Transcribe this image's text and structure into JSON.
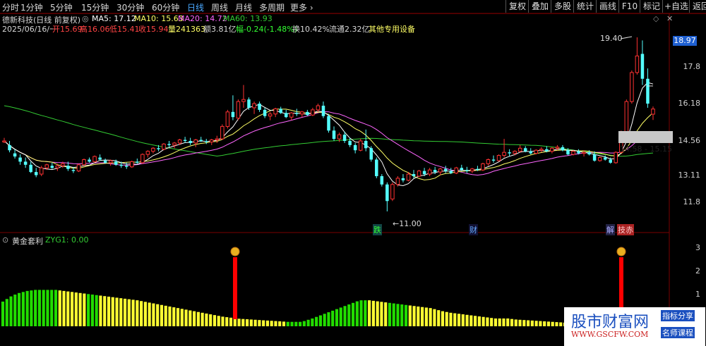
{
  "toolbar": {
    "periods": [
      "分时",
      "1分钟",
      "5分钟",
      "15分钟",
      "30分钟",
      "60分钟",
      "日线",
      "周线",
      "月线",
      "多周期",
      "更多"
    ],
    "active_period": "日线",
    "right_buttons": [
      "复权",
      "叠加",
      "多股",
      "统计",
      "画线",
      "F10",
      "标记",
      "+自选",
      "返回"
    ]
  },
  "header": {
    "title": "德新科技(日线 前复权)",
    "ma5": "MA5: 17.12",
    "ma10": "MA10: 15.63",
    "ma20": "MA20: 14.72",
    "ma60": "MA60: 13.93",
    "date": "2025/06/16/一",
    "open": "开15.69",
    "high": "高16.06",
    "low": "低15.41",
    "close": "收15.94",
    "volume": "量241363",
    "amount": "额3.81亿",
    "change": "幅-0.24(-1.48%)",
    "turnover": "换10.42%",
    "float": "流通2.32亿",
    "industry": "其他专用设备"
  },
  "colors": {
    "up": "#ff3232",
    "down": "#54ffff",
    "ma5": "#ffffff",
    "ma10": "#ffff66",
    "ma20": "#ff66ff",
    "ma60": "#33cc33",
    "bar_green": "#22dd00",
    "bar_yellow": "#ffff33",
    "signal": "#ff0000",
    "price_box": "#1e5fd0"
  },
  "annotations": {
    "high_label": "19.40",
    "low_label": "←11.00",
    "range_label": "14.58 - 15.15",
    "event_fall": "跌",
    "event_finance": "财",
    "event_unlock": "解",
    "event_special": "技赤",
    "current_price": "18.97"
  },
  "indicator": {
    "name": "黄金套利",
    "value": "ZYG1: 0.00"
  },
  "watermark": {
    "site_cn": "股市财富网",
    "url": "WWW.GSCFW.COM",
    "tag1": "指标分享",
    "tag2": "名师课程"
  },
  "chart_data": [
    {
      "type": "candlestick",
      "y_ticks": [
        11.8,
        13.11,
        14.56,
        16.18,
        17.8,
        18.97
      ],
      "ylim": [
        11.0,
        19.5
      ],
      "candles": [
        {
          "o": 14.35,
          "h": 14.55,
          "l": 14.3,
          "c": 14.4
        },
        {
          "o": 14.2,
          "h": 14.4,
          "l": 13.85,
          "c": 13.95
        },
        {
          "o": 13.8,
          "h": 14.0,
          "l": 13.55,
          "c": 13.65
        },
        {
          "o": 13.6,
          "h": 13.75,
          "l": 13.25,
          "c": 13.4
        },
        {
          "o": 13.4,
          "h": 13.6,
          "l": 13.1,
          "c": 13.25
        },
        {
          "o": 13.25,
          "h": 13.4,
          "l": 12.85,
          "c": 12.9
        },
        {
          "o": 12.9,
          "h": 13.1,
          "l": 12.65,
          "c": 12.75
        },
        {
          "o": 12.8,
          "h": 13.2,
          "l": 12.7,
          "c": 13.1
        },
        {
          "o": 13.1,
          "h": 13.3,
          "l": 13.0,
          "c": 13.25
        },
        {
          "o": 13.2,
          "h": 13.35,
          "l": 13.05,
          "c": 13.1
        },
        {
          "o": 13.1,
          "h": 13.3,
          "l": 12.95,
          "c": 13.2
        },
        {
          "o": 13.2,
          "h": 13.4,
          "l": 13.1,
          "c": 13.3
        },
        {
          "o": 13.2,
          "h": 13.4,
          "l": 12.95,
          "c": 13.05
        },
        {
          "o": 13.0,
          "h": 13.15,
          "l": 12.85,
          "c": 12.95
        },
        {
          "o": 12.95,
          "h": 13.3,
          "l": 12.9,
          "c": 13.25
        },
        {
          "o": 13.25,
          "h": 13.55,
          "l": 13.2,
          "c": 13.5
        },
        {
          "o": 13.5,
          "h": 13.6,
          "l": 13.35,
          "c": 13.4
        },
        {
          "o": 13.4,
          "h": 13.7,
          "l": 13.35,
          "c": 13.65
        },
        {
          "o": 13.6,
          "h": 13.75,
          "l": 13.45,
          "c": 13.5
        },
        {
          "o": 13.45,
          "h": 13.55,
          "l": 13.3,
          "c": 13.35
        },
        {
          "o": 13.35,
          "h": 13.5,
          "l": 13.2,
          "c": 13.45
        },
        {
          "o": 13.4,
          "h": 13.5,
          "l": 13.2,
          "c": 13.25
        },
        {
          "o": 13.25,
          "h": 13.4,
          "l": 13.1,
          "c": 13.2
        },
        {
          "o": 13.2,
          "h": 13.35,
          "l": 13.05,
          "c": 13.15
        },
        {
          "o": 13.15,
          "h": 13.45,
          "l": 13.1,
          "c": 13.4
        },
        {
          "o": 13.4,
          "h": 13.55,
          "l": 13.3,
          "c": 13.35
        },
        {
          "o": 13.35,
          "h": 13.8,
          "l": 13.3,
          "c": 13.75
        },
        {
          "o": 13.75,
          "h": 13.95,
          "l": 13.6,
          "c": 13.9
        },
        {
          "o": 13.9,
          "h": 14.1,
          "l": 13.8,
          "c": 14.05
        },
        {
          "o": 14.05,
          "h": 14.2,
          "l": 13.9,
          "c": 14.0
        },
        {
          "o": 14.0,
          "h": 14.3,
          "l": 13.95,
          "c": 14.25
        },
        {
          "o": 14.25,
          "h": 14.4,
          "l": 14.1,
          "c": 14.2
        },
        {
          "o": 14.2,
          "h": 14.35,
          "l": 14.05,
          "c": 14.3
        },
        {
          "o": 14.3,
          "h": 14.5,
          "l": 14.2,
          "c": 14.45
        },
        {
          "o": 14.45,
          "h": 14.6,
          "l": 14.3,
          "c": 14.4
        },
        {
          "o": 14.4,
          "h": 14.55,
          "l": 14.2,
          "c": 14.3
        },
        {
          "o": 14.3,
          "h": 14.5,
          "l": 14.1,
          "c": 14.45
        },
        {
          "o": 14.45,
          "h": 14.6,
          "l": 14.35,
          "c": 14.4
        },
        {
          "o": 14.4,
          "h": 14.5,
          "l": 14.25,
          "c": 14.35
        },
        {
          "o": 14.35,
          "h": 14.5,
          "l": 14.2,
          "c": 14.45
        },
        {
          "o": 14.45,
          "h": 14.65,
          "l": 14.3,
          "c": 14.5
        },
        {
          "o": 14.5,
          "h": 15.2,
          "l": 14.45,
          "c": 15.1
        },
        {
          "o": 15.1,
          "h": 15.9,
          "l": 15.0,
          "c": 15.8
        },
        {
          "o": 15.8,
          "h": 16.6,
          "l": 15.4,
          "c": 15.55
        },
        {
          "o": 15.5,
          "h": 16.4,
          "l": 15.4,
          "c": 16.3
        },
        {
          "o": 16.3,
          "h": 17.1,
          "l": 16.0,
          "c": 16.4
        },
        {
          "o": 16.4,
          "h": 16.5,
          "l": 15.9,
          "c": 16.0
        },
        {
          "o": 16.0,
          "h": 16.3,
          "l": 15.7,
          "c": 16.2
        },
        {
          "o": 16.2,
          "h": 16.3,
          "l": 15.8,
          "c": 15.9
        },
        {
          "o": 15.9,
          "h": 16.0,
          "l": 15.5,
          "c": 15.6
        },
        {
          "o": 15.6,
          "h": 15.8,
          "l": 15.4,
          "c": 15.7
        },
        {
          "o": 15.7,
          "h": 16.0,
          "l": 15.55,
          "c": 15.95
        },
        {
          "o": 15.95,
          "h": 16.05,
          "l": 15.7,
          "c": 15.75
        },
        {
          "o": 15.75,
          "h": 15.9,
          "l": 15.5,
          "c": 15.55
        },
        {
          "o": 15.55,
          "h": 15.8,
          "l": 15.4,
          "c": 15.75
        },
        {
          "o": 15.75,
          "h": 15.95,
          "l": 15.6,
          "c": 15.7
        },
        {
          "o": 15.7,
          "h": 15.85,
          "l": 15.55,
          "c": 15.8
        },
        {
          "o": 15.8,
          "h": 15.9,
          "l": 15.6,
          "c": 15.65
        },
        {
          "o": 15.65,
          "h": 16.0,
          "l": 15.6,
          "c": 15.9
        },
        {
          "o": 15.9,
          "h": 16.2,
          "l": 15.8,
          "c": 16.1
        },
        {
          "o": 16.1,
          "h": 16.3,
          "l": 15.5,
          "c": 15.6
        },
        {
          "o": 15.6,
          "h": 15.7,
          "l": 14.8,
          "c": 14.9
        },
        {
          "o": 14.9,
          "h": 15.1,
          "l": 14.4,
          "c": 14.5
        },
        {
          "o": 14.5,
          "h": 14.8,
          "l": 14.35,
          "c": 14.7
        },
        {
          "o": 14.7,
          "h": 14.85,
          "l": 14.3,
          "c": 14.4
        },
        {
          "o": 14.4,
          "h": 14.55,
          "l": 14.1,
          "c": 14.2
        },
        {
          "o": 14.2,
          "h": 14.3,
          "l": 13.8,
          "c": 13.95
        },
        {
          "o": 13.95,
          "h": 14.5,
          "l": 13.9,
          "c": 14.4
        },
        {
          "o": 14.4,
          "h": 14.95,
          "l": 13.9,
          "c": 14.05
        },
        {
          "o": 14.05,
          "h": 14.15,
          "l": 13.4,
          "c": 13.5
        },
        {
          "o": 13.5,
          "h": 13.6,
          "l": 12.6,
          "c": 12.7
        },
        {
          "o": 12.7,
          "h": 12.8,
          "l": 12.2,
          "c": 12.3
        },
        {
          "o": 12.3,
          "h": 12.4,
          "l": 11.0,
          "c": 11.5
        },
        {
          "o": 11.6,
          "h": 12.4,
          "l": 11.5,
          "c": 12.3
        },
        {
          "o": 12.3,
          "h": 12.7,
          "l": 12.2,
          "c": 12.6
        },
        {
          "o": 12.6,
          "h": 12.8,
          "l": 12.4,
          "c": 12.5
        },
        {
          "o": 12.5,
          "h": 12.9,
          "l": 12.45,
          "c": 12.8
        },
        {
          "o": 12.8,
          "h": 13.0,
          "l": 12.6,
          "c": 12.7
        },
        {
          "o": 12.7,
          "h": 13.0,
          "l": 12.65,
          "c": 12.95
        },
        {
          "o": 12.95,
          "h": 13.1,
          "l": 12.7,
          "c": 12.8
        },
        {
          "o": 12.8,
          "h": 13.1,
          "l": 12.7,
          "c": 13.0
        },
        {
          "o": 13.0,
          "h": 13.15,
          "l": 12.8,
          "c": 12.9
        },
        {
          "o": 12.9,
          "h": 13.1,
          "l": 12.75,
          "c": 13.05
        },
        {
          "o": 13.05,
          "h": 13.2,
          "l": 12.85,
          "c": 12.95
        },
        {
          "o": 12.95,
          "h": 13.1,
          "l": 12.8,
          "c": 12.85
        },
        {
          "o": 12.85,
          "h": 13.15,
          "l": 12.8,
          "c": 13.1
        },
        {
          "o": 13.1,
          "h": 13.25,
          "l": 12.95,
          "c": 13.0
        },
        {
          "o": 13.0,
          "h": 13.15,
          "l": 12.85,
          "c": 12.95
        },
        {
          "o": 12.95,
          "h": 13.1,
          "l": 12.85,
          "c": 13.05
        },
        {
          "o": 13.05,
          "h": 13.2,
          "l": 12.95,
          "c": 13.0
        },
        {
          "o": 13.0,
          "h": 13.35,
          "l": 12.95,
          "c": 13.3
        },
        {
          "o": 13.3,
          "h": 13.55,
          "l": 13.2,
          "c": 13.5
        },
        {
          "o": 13.5,
          "h": 13.7,
          "l": 13.35,
          "c": 13.45
        },
        {
          "o": 13.45,
          "h": 13.75,
          "l": 13.4,
          "c": 13.7
        },
        {
          "o": 13.7,
          "h": 14.5,
          "l": 13.6,
          "c": 13.85
        },
        {
          "o": 13.85,
          "h": 14.0,
          "l": 13.65,
          "c": 13.8
        },
        {
          "o": 13.8,
          "h": 13.95,
          "l": 13.7,
          "c": 13.9
        },
        {
          "o": 13.9,
          "h": 14.2,
          "l": 13.85,
          "c": 14.05
        },
        {
          "o": 14.05,
          "h": 14.15,
          "l": 13.85,
          "c": 13.9
        },
        {
          "o": 13.9,
          "h": 14.05,
          "l": 13.75,
          "c": 13.8
        },
        {
          "o": 13.8,
          "h": 14.0,
          "l": 13.75,
          "c": 13.95
        },
        {
          "o": 13.95,
          "h": 14.1,
          "l": 13.85,
          "c": 14.0
        },
        {
          "o": 14.0,
          "h": 14.15,
          "l": 13.85,
          "c": 13.9
        },
        {
          "o": 13.9,
          "h": 14.1,
          "l": 13.8,
          "c": 14.05
        },
        {
          "o": 14.05,
          "h": 14.2,
          "l": 13.95,
          "c": 14.1
        },
        {
          "o": 14.1,
          "h": 14.2,
          "l": 13.9,
          "c": 13.95
        },
        {
          "o": 13.95,
          "h": 14.05,
          "l": 13.7,
          "c": 13.75
        },
        {
          "o": 13.75,
          "h": 13.95,
          "l": 13.7,
          "c": 13.9
        },
        {
          "o": 13.9,
          "h": 14.0,
          "l": 13.75,
          "c": 13.8
        },
        {
          "o": 13.8,
          "h": 13.95,
          "l": 13.65,
          "c": 13.85
        },
        {
          "o": 13.85,
          "h": 13.95,
          "l": 13.7,
          "c": 13.75
        },
        {
          "o": 13.75,
          "h": 13.9,
          "l": 13.4,
          "c": 13.45
        },
        {
          "o": 13.45,
          "h": 13.65,
          "l": 13.4,
          "c": 13.6
        },
        {
          "o": 13.6,
          "h": 13.7,
          "l": 13.45,
          "c": 13.5
        },
        {
          "o": 13.5,
          "h": 13.6,
          "l": 13.3,
          "c": 13.35
        },
        {
          "o": 13.35,
          "h": 13.9,
          "l": 13.3,
          "c": 13.85
        },
        {
          "o": 13.85,
          "h": 14.9,
          "l": 13.8,
          "c": 14.85
        },
        {
          "o": 14.85,
          "h": 16.4,
          "l": 14.8,
          "c": 16.3
        },
        {
          "o": 16.3,
          "h": 17.8,
          "l": 16.2,
          "c": 17.7
        },
        {
          "o": 17.7,
          "h": 19.4,
          "l": 17.6,
          "c": 18.5
        },
        {
          "o": 18.6,
          "h": 19.25,
          "l": 17.1,
          "c": 17.4
        },
        {
          "o": 17.4,
          "h": 17.9,
          "l": 16.0,
          "c": 16.2
        },
        {
          "o": 15.69,
          "h": 16.06,
          "l": 15.41,
          "c": 15.94
        }
      ]
    },
    {
      "type": "bar",
      "name": "黄金套利",
      "y_ticks": [
        1.0,
        2.0,
        3.0
      ],
      "ylim": [
        0,
        3.2
      ],
      "values": [
        0.95,
        1.05,
        1.15,
        1.22,
        1.28,
        1.32,
        1.36,
        1.38,
        1.4,
        1.4,
        1.4,
        1.4,
        1.4,
        1.4,
        1.38,
        1.36,
        1.34,
        1.32,
        1.3,
        1.28,
        1.26,
        1.24,
        1.22,
        1.2,
        1.18,
        1.16,
        1.14,
        1.12,
        1.1,
        1.08,
        1.06,
        1.04,
        1.02,
        1.0,
        0.97,
        0.94,
        0.91,
        0.88,
        0.85,
        0.82,
        0.79,
        0.76,
        0.73,
        0.7,
        0.67,
        0.64,
        0.61,
        0.58,
        0.55,
        0.52,
        0.49,
        0.46,
        0.43,
        0.4,
        0.37,
        0.35,
        0.33,
        0.31,
        0.29,
        0.28,
        0.27,
        0.26,
        0.25,
        0.24,
        0.23,
        0.22,
        0.21,
        0.2,
        0.19,
        0.18,
        0.17,
        0.17,
        0.17,
        0.17,
        0.2,
        0.25,
        0.3,
        0.36,
        0.42,
        0.48,
        0.54,
        0.6,
        0.66,
        0.72,
        0.78,
        0.84,
        0.9,
        0.96,
        1.0,
        1.0,
        1.0,
        0.98,
        0.96,
        0.94,
        0.92,
        0.9,
        0.88,
        0.86,
        0.84,
        0.82,
        0.8,
        0.78,
        0.76,
        0.74,
        0.72,
        0.7,
        0.66,
        0.62,
        0.58,
        0.55,
        0.52,
        0.5,
        0.48,
        0.46,
        0.44,
        0.42,
        0.4,
        0.38,
        0.36,
        0.34,
        0.32,
        0.3,
        0.3,
        0.3,
        0.3,
        0.28,
        0.26,
        0.25,
        0.24,
        0.23,
        0.22,
        0.21,
        0.2,
        0.19,
        0.18,
        0.17,
        0.16,
        0.15,
        0.14
      ],
      "colors": [
        "g",
        "g",
        "g",
        "g",
        "g",
        "g",
        "g",
        "g",
        "g",
        "g",
        "g",
        "g",
        "g",
        "g",
        "y",
        "y",
        "y",
        "y",
        "y",
        "y",
        "y",
        "g",
        "g",
        "g",
        "y",
        "y",
        "y",
        "y",
        "y",
        "y",
        "y",
        "y",
        "y",
        "y",
        "y",
        "y",
        "y",
        "y",
        "y",
        "y",
        "y",
        "y",
        "y",
        "y",
        "y",
        "y",
        "y",
        "y",
        "y",
        "y",
        "y",
        "y",
        "y",
        "y",
        "y",
        "y",
        "y",
        "y",
        "y",
        "y",
        "y",
        "y",
        "y",
        "y",
        "y",
        "y",
        "y",
        "y",
        "y",
        "y",
        "g",
        "g",
        "g",
        "g",
        "g",
        "g",
        "g",
        "g",
        "g",
        "g",
        "g",
        "g",
        "g",
        "g",
        "g",
        "g",
        "g",
        "g",
        "g",
        "g",
        "y",
        "y",
        "y",
        "y",
        "y",
        "g",
        "g",
        "g",
        "g",
        "g",
        "y",
        "y",
        "y",
        "y",
        "y",
        "y",
        "y",
        "y",
        "y",
        "y",
        "y",
        "y",
        "y",
        "y",
        "y",
        "y",
        "y",
        "y",
        "y",
        "y",
        "y",
        "y",
        "y",
        "y",
        "y",
        "y",
        "y",
        "y",
        "y",
        "y",
        "y",
        "y",
        "y",
        "y",
        "y",
        "y",
        "y",
        "y",
        "y"
      ],
      "signals_at": [
        42,
        122
      ],
      "last_values": [
        0.27,
        0.3,
        0.35,
        0.33
      ]
    }
  ]
}
